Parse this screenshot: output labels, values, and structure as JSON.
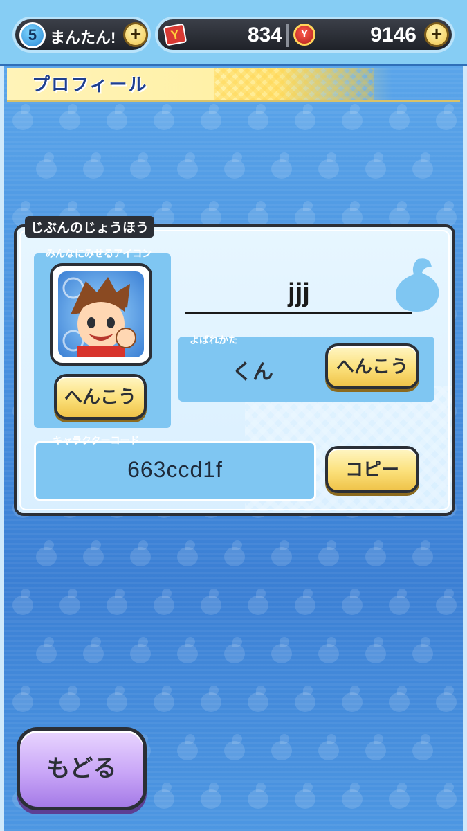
{
  "top_bar": {
    "level": "5",
    "mode_label": "まんたん!",
    "gems": "834",
    "coins": "9146",
    "add_symbol": "+",
    "gem_symbol": "Y",
    "coin_symbol": "Y"
  },
  "header": {
    "title": "プロフィール"
  },
  "profile": {
    "section_label": "じぶんのじょうほう",
    "icon_label": "みんなにみせるアイコン",
    "icon_change_button": "へんこう",
    "name": "jjj",
    "yobikata_label": "よばれかた",
    "yobikata_value": "くん",
    "yobikata_change_button": "へんこう",
    "character_code_label": "キャラクターコード",
    "character_code": "663ccd1f",
    "copy_button": "コピー"
  },
  "footer": {
    "back_button": "もどる"
  },
  "colors": {
    "background": "#4a93e0",
    "panel": "#e7f6ff",
    "button_yellow": "#fbe07a",
    "button_purple": "#c9a6f7",
    "header_ribbon": "#fff1a8"
  },
  "icons": [
    "level-badge-icon",
    "plus-icon",
    "gem-icon",
    "coin-icon",
    "character-avatar",
    "drop-emblem-icon"
  ]
}
